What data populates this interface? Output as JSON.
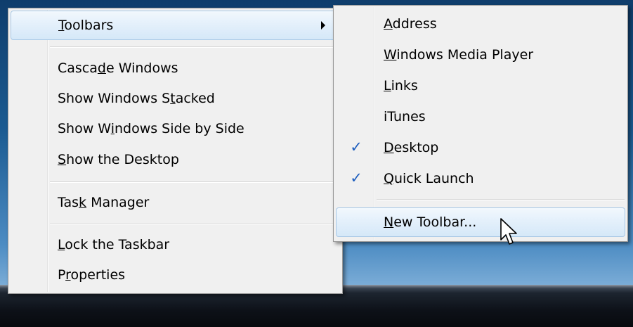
{
  "context_menu": {
    "items": [
      {
        "label": "Toolbars",
        "accel": "T",
        "has_submenu": true,
        "highlighted": true
      },
      {
        "label": "Cascade Windows",
        "accel": "d"
      },
      {
        "label": "Show Windows Stacked",
        "accel": "t"
      },
      {
        "label": "Show Windows Side by Side",
        "accel": "i"
      },
      {
        "label": "Show the Desktop",
        "accel": "S"
      },
      {
        "label": "Task Manager",
        "accel": "k"
      },
      {
        "label": "Lock the Taskbar",
        "accel": "L"
      },
      {
        "label": "Properties",
        "accel": "r"
      }
    ]
  },
  "toolbars_submenu": {
    "items": [
      {
        "label": "Address",
        "accel": "A",
        "checked": false
      },
      {
        "label": "Windows Media Player",
        "accel": "W",
        "checked": false
      },
      {
        "label": "Links",
        "accel": "L",
        "checked": false
      },
      {
        "label": "iTunes",
        "checked": false
      },
      {
        "label": "Desktop",
        "accel": "D",
        "checked": true
      },
      {
        "label": "Quick Launch",
        "accel": "Q",
        "checked": true
      },
      {
        "label": "New Toolbar...",
        "accel": "N",
        "highlighted": true
      }
    ],
    "check_glyph": "✓"
  },
  "colors": {
    "menu_bg": "#f0f0f0",
    "highlight": "#d5e8f8",
    "check": "#1f5fbf"
  }
}
